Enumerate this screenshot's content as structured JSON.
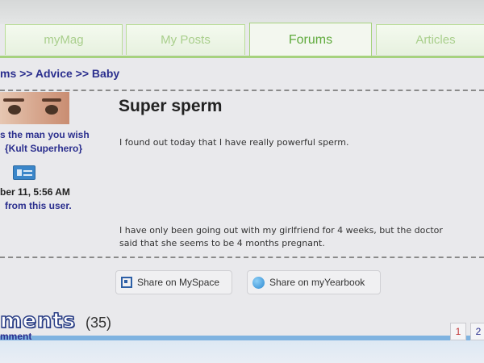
{
  "tabs": [
    {
      "label": "myMag",
      "active": false
    },
    {
      "label": "My Posts",
      "active": false
    },
    {
      "label": "Forums",
      "active": true
    },
    {
      "label": "Articles",
      "active": false
    }
  ],
  "breadcrumb": {
    "items": [
      "ms",
      "Advice",
      "Baby"
    ],
    "separator": ">>"
  },
  "user": {
    "tagline": "s the man you wish",
    "rank": "{Kult Superhero}",
    "date": "ber 11, 5:56 AM",
    "more_link": "from this user."
  },
  "post": {
    "title": "Super sperm",
    "line1": "I found out today that I have really powerful sperm.",
    "line2": "I have only been going out with my girlfriend for 4 weeks, but the doctor",
    "line3": "said that she seems to be 4 months pregnant."
  },
  "share": {
    "myspace_label": "Share on MySpace",
    "myyearbook_label": "Share on myYearbook"
  },
  "comments": {
    "heading": "ments",
    "count": "(35)",
    "link": "mment"
  },
  "pagination": [
    "1",
    "2"
  ],
  "colors": {
    "tab_border": "#a6d27e",
    "tab_active_text": "#5faa3c",
    "link_blue": "#2b2f8e",
    "current_page": "#c03030"
  }
}
